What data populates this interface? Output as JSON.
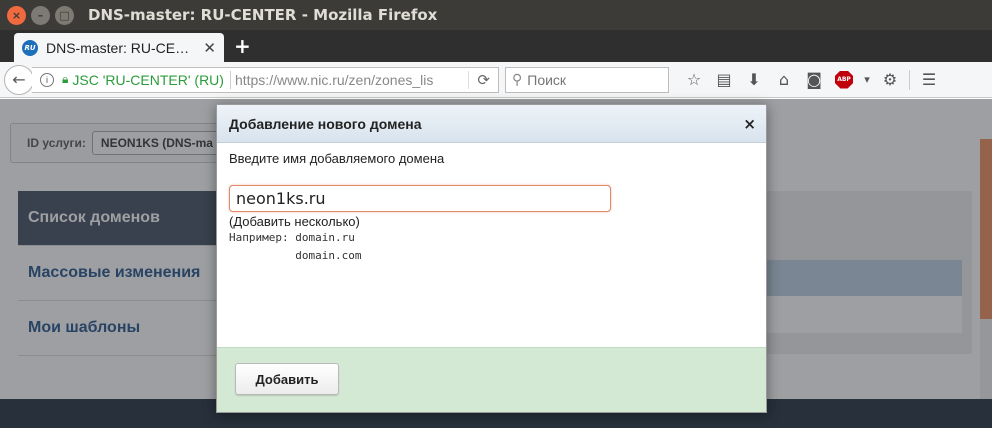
{
  "window": {
    "title": "DNS-master: RU-CENTER - Mozilla Firefox"
  },
  "tab": {
    "label": "DNS-master: RU-CE…",
    "favicon_text": "RU"
  },
  "navbar": {
    "site_identity": "JSC 'RU-CENTER' (RU)",
    "url": "https://www.nic.ru/zen/zones_lis",
    "search_placeholder": "Поиск",
    "abp_text": "ABP"
  },
  "page": {
    "service_label": "ID услуги:",
    "service_value": "NEON1KS (DNS-ma",
    "sidebar": {
      "items": [
        {
          "label": "Список доменов"
        },
        {
          "label": "Массовые изменения"
        },
        {
          "label": "Мои шаблоны"
        }
      ]
    }
  },
  "modal": {
    "title": "Добавление нового домена",
    "close": "×",
    "prompt": "Введите имя добавляемого домена",
    "input_value": "neon1ks.ru",
    "add_multiple": "(Добавить несколько)",
    "example": "Например: domain.ru\n          domain.com",
    "add_button": "Добавить"
  },
  "colors": {
    "accent": "#1f4f86",
    "modal_footer": "#d4e9d4",
    "input_border": "#e08a6a"
  }
}
